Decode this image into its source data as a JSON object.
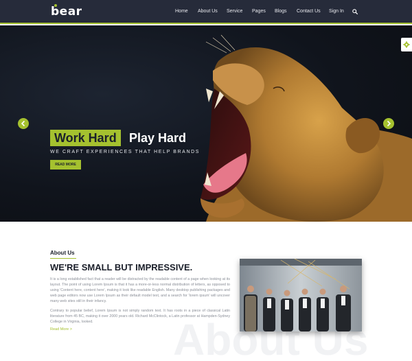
{
  "brand": {
    "logo_text": "bear",
    "accent_color": "#a5c12f",
    "nav_bg": "#262b3a"
  },
  "nav": {
    "items": [
      {
        "label": "Home"
      },
      {
        "label": "About Us"
      },
      {
        "label": "Service"
      },
      {
        "label": "Pages"
      },
      {
        "label": "Blogs"
      },
      {
        "label": "Contact Us"
      },
      {
        "label": "Sign In"
      }
    ],
    "search_icon": "search-icon"
  },
  "hero": {
    "title_highlight": "Work Hard",
    "title_rest": "Play Hard",
    "subtitle": "WE CRAFT EXPERIENCES THAT HELP BRANDS",
    "cta_label": "READ MORE",
    "prev_icon": "chevron-left-icon",
    "next_icon": "chevron-right-icon",
    "slides_total": 3,
    "active_slide": 1
  },
  "settings_icon": "gear-icon",
  "about": {
    "label": "About Us",
    "heading": "WE'RE SMALL BUT IMPRESSIVE.",
    "paragraph1": "It is a long established fact that a reader will be distracted by the readable content of a page when looking at its layout. The point of using Lorem Ipsum is that it has a more-or-less normal distribution of letters, as opposed to using 'Content here, content here', making it look like readable English. Many desktop publishing packages and web page editors now use Lorem Ipsum as their default model text, and a search for 'lorem ipsum' will uncover many web sites still in their infancy.",
    "paragraph2": "Contrary to popular belief, Lorem Ipsum is not simply random text. It has roots in a piece of classical Latin literature from 45 BC, making it over 2000 years old. Richard McClintock, a Latin professor at Hampden-Sydney College in Virginia, looked.",
    "read_more": "Read More >",
    "watermark": "About Us"
  }
}
